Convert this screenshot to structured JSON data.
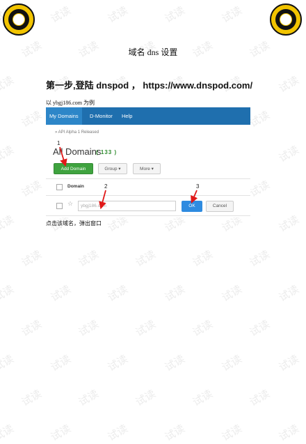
{
  "watermark": "试读",
  "document": {
    "title": "域名 dns 设置",
    "step_heading": "第一步,登陆 dnspod ，  https://www.dnspod.com/",
    "example_text": "以  ybgj186.com  为例",
    "after_text": "点击该域名，弹出窗口"
  },
  "screenshot": {
    "nav": [
      "My Domains",
      "D-Monitor",
      "Help"
    ],
    "release_note": "» API Alpha 1 Released",
    "heading": "All Domains",
    "count": "( 133 )",
    "add_button": "Add Domain",
    "group_button": "Group ▾",
    "more_button": "More ▾",
    "column_domain": "Domain",
    "domain_value": "ybgj186.com",
    "ok_button": "OK",
    "cancel_button": "Cancel",
    "star_glyph": "☆",
    "markers": [
      "1",
      "2",
      "3"
    ],
    "colors": {
      "navbar": "#1f6fae",
      "add_button": "#3fa33f",
      "ok_button": "#2e8be0",
      "arrow": "#e01818"
    }
  }
}
